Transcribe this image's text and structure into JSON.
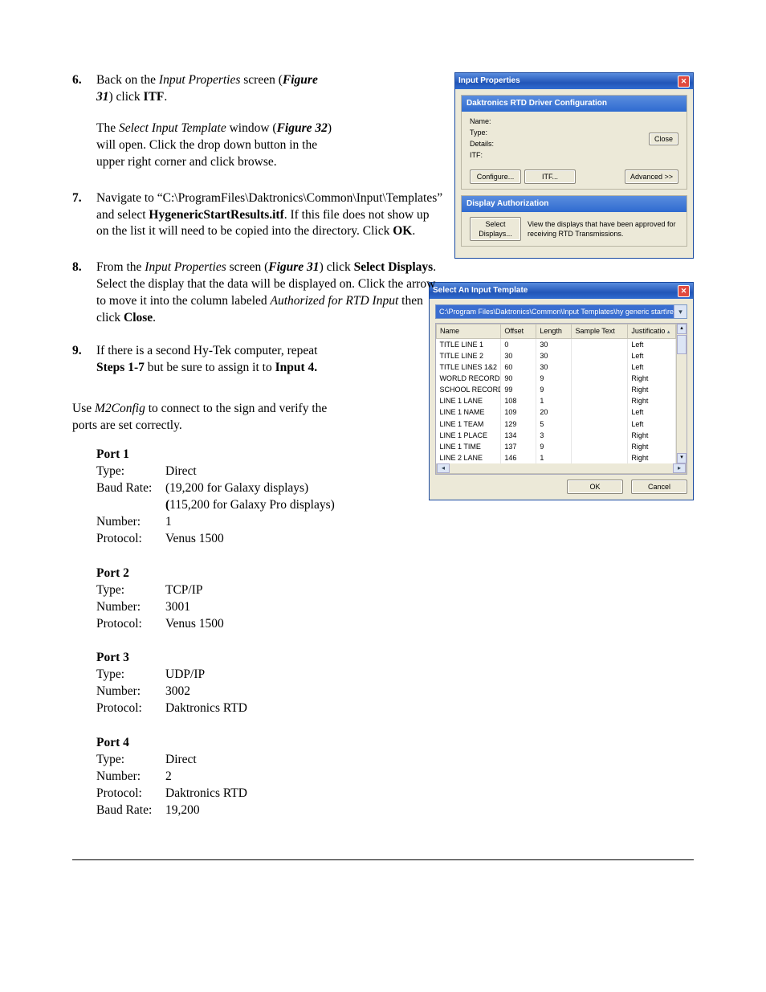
{
  "steps": {
    "s6": {
      "num": "6.",
      "p1a": "Back on the ",
      "p1b": "Input Properties",
      "p1c": " screen (",
      "p1d": "Figure 31",
      "p1e": ") click ",
      "p1f": "ITF",
      "p1g": ".",
      "p2a": "The ",
      "p2b": "Select Input Template",
      "p2c": " window (",
      "p2d": "Figure 32",
      "p2e": ") will open. Click the drop down button in the upper right corner and click browse."
    },
    "s7": {
      "num": "7.",
      "p1a": "Navigate to “C:\\ProgramFiles\\Daktronics\\Common\\Input\\Templates” and select ",
      "p1b": "HygenericStartResults.itf",
      "p1c": ". If this file does not show up on the list it will need to be copied into the directory. Click ",
      "p1d": "OK",
      "p1e": "."
    },
    "s8": {
      "num": "8.",
      "p1a": "From the ",
      "p1b": "Input Properties",
      "p1c": " screen (",
      "p1d": "Figure 31",
      "p1e": ") click ",
      "p1f": "Select Displays",
      "p1g": ". Select the display that the data will be displayed on. Click the arrow to move it into the column labeled ",
      "p1h": "Authorized for RTD Input",
      "p1i": " then click ",
      "p1j": "Close",
      "p1k": "."
    },
    "s9": {
      "num": "9.",
      "p1a": "If there is a second Hy-Tek computer, repeat ",
      "p1b": "Steps 1-7",
      "p1c": " but be sure to assign it to ",
      "p1d": "Input 4."
    }
  },
  "post": {
    "p1a": "Use ",
    "p1b": "M2Config",
    "p1c": " to connect to the sign and verify the ports are set correctly."
  },
  "ports": [
    {
      "title": "Port 1",
      "rows": [
        [
          "Type:",
          "Direct"
        ],
        [
          "Baud Rate:",
          "(19,200 for Galaxy displays)"
        ],
        [
          "",
          "(115,200 for Galaxy Pro displays)"
        ],
        [
          "Number:",
          "1"
        ],
        [
          "Protocol:",
          "Venus 1500"
        ]
      ]
    },
    {
      "title": "Port 2",
      "rows": [
        [
          "Type:",
          "TCP/IP"
        ],
        [
          "Number:",
          "3001"
        ],
        [
          "Protocol:",
          "Venus 1500"
        ]
      ]
    },
    {
      "title": "Port 3",
      "rows": [
        [
          "Type:",
          "UDP/IP"
        ],
        [
          "Number:",
          "3002"
        ],
        [
          "Protocol:",
          "Daktronics RTD"
        ]
      ]
    },
    {
      "title": "Port 4",
      "rows": [
        [
          "Type:",
          "Direct"
        ],
        [
          "Number:",
          "2"
        ],
        [
          "Protocol:",
          "Daktronics RTD"
        ],
        [
          "Baud Rate:",
          "19,200"
        ]
      ]
    }
  ],
  "win1": {
    "title": "Input Properties",
    "section1": "Daktronics RTD Driver Configuration",
    "labels": {
      "name": "Name:",
      "type": "Type:",
      "details": "Details:",
      "itf": "ITF:"
    },
    "close_btn": "Close",
    "configure_btn": "Configure...",
    "itf_btn": "ITF...",
    "advanced_btn": "Advanced >>",
    "section2": "Display Authorization",
    "select_displays_btn": "Select Displays...",
    "auth_text": "View the displays that have been approved for receiving RTD Transmissions."
  },
  "win2": {
    "title": "Select An Input Template",
    "combo": "C:\\Program Files\\Daktronics\\Common\\Input Templates\\hy generic start\\results.itf",
    "headers": [
      "Name",
      "Offset",
      "Length",
      "Sample Text",
      "Justificatio"
    ],
    "rows": [
      [
        "TITLE LINE 1",
        "0",
        "30",
        "",
        "Left"
      ],
      [
        "TITLE LINE 2",
        "30",
        "30",
        "",
        "Left"
      ],
      [
        "TITLE LINES 1&2",
        "60",
        "30",
        "",
        "Left"
      ],
      [
        "WORLD RECORD",
        "90",
        "9",
        "",
        "Right"
      ],
      [
        "SCHOOL RECORD",
        "99",
        "9",
        "",
        "Right"
      ],
      [
        "LINE 1 LANE",
        "108",
        "1",
        "",
        "Right"
      ],
      [
        "LINE 1 NAME",
        "109",
        "20",
        "",
        "Left"
      ],
      [
        "LINE 1 TEAM",
        "129",
        "5",
        "",
        "Left"
      ],
      [
        "LINE 1 PLACE",
        "134",
        "3",
        "",
        "Right"
      ],
      [
        "LINE 1 TIME",
        "137",
        "9",
        "",
        "Right"
      ],
      [
        "LINE 2 LANE",
        "146",
        "1",
        "",
        "Right"
      ]
    ],
    "ok": "OK",
    "cancel": "Cancel"
  }
}
